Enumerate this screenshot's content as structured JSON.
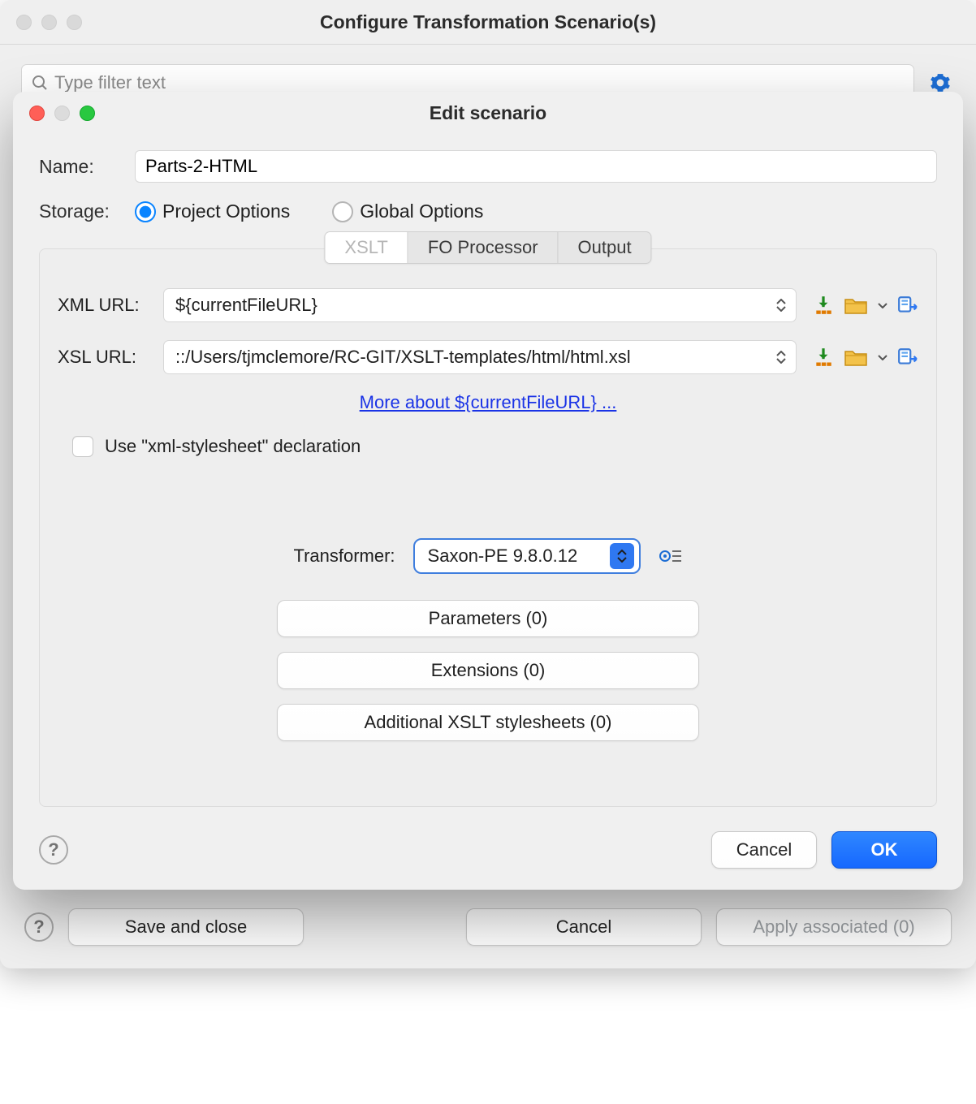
{
  "outer": {
    "title": "Configure Transformation Scenario(s)",
    "filter_placeholder": "Type filter text",
    "help_icon": "question-mark",
    "settings_icon": "gear-icon",
    "save_label": "Save and close",
    "cancel_label": "Cancel",
    "apply_label": "Apply associated (0)"
  },
  "dialog": {
    "title": "Edit scenario",
    "name_label": "Name:",
    "name_value": "Parts-2-HTML",
    "storage_label": "Storage:",
    "radio_project": "Project Options",
    "radio_global": "Global Options",
    "storage_selected": "project",
    "tabs": {
      "xslt": "XSLT",
      "fo": "FO Processor",
      "output": "Output",
      "active": "xslt"
    },
    "xml_url_label": "XML URL:",
    "xml_url_value": "${currentFileURL}",
    "xsl_url_label": "XSL URL:",
    "xsl_url_value": "::/Users/tjmclemore/RC-GIT/XSLT-templates/html/html.xsl",
    "more_link": "More about ${currentFileURL} ...",
    "use_xml_stylesheet": "Use \"xml-stylesheet\" declaration",
    "use_xml_stylesheet_checked": false,
    "transformer_label": "Transformer:",
    "transformer_value": "Saxon-PE 9.8.0.12",
    "buttons": {
      "parameters": "Parameters (0)",
      "extensions": "Extensions (0)",
      "additional": "Additional XSLT stylesheets (0)"
    },
    "help_icon": "question-mark",
    "cancel": "Cancel",
    "ok": "OK"
  },
  "icons": {
    "variables": "insert-variables-icon",
    "browse": "folder-icon",
    "browse_chevron": "chevron-down-icon",
    "open_editor": "open-in-editor-icon",
    "gear_lines": "advanced-options-icon"
  }
}
